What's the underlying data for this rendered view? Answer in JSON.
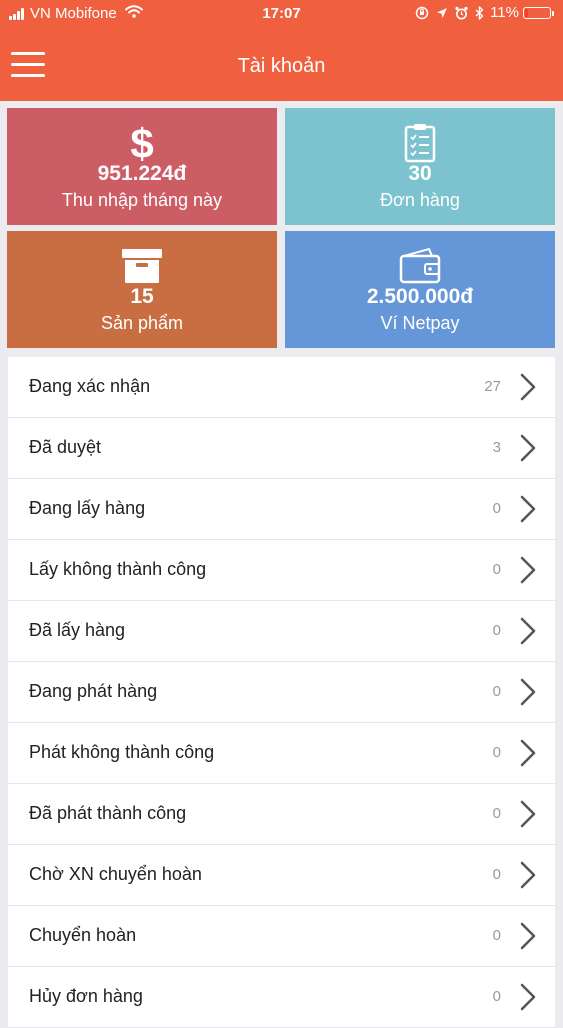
{
  "status_bar": {
    "carrier": "VN Mobifone",
    "time": "17:07",
    "battery": "11%"
  },
  "header": {
    "title": "Tài khoản",
    "menu_icon": "hamburger-menu-icon"
  },
  "tiles": [
    {
      "icon": "dollar-icon",
      "value": "951.224đ",
      "label": "Thu nhập tháng này",
      "color": "#cd5d65"
    },
    {
      "icon": "clipboard-icon",
      "value": "30",
      "label": "Đơn hàng",
      "color": "#7cc3cf"
    },
    {
      "icon": "archive-box-icon",
      "value": "15",
      "label": "Sản phẩm",
      "color": "#c96d42"
    },
    {
      "icon": "wallet-icon",
      "value": "2.500.000đ",
      "label": "Ví Netpay",
      "color": "#6597d8"
    }
  ],
  "list": [
    {
      "label": "Đang xác nhận",
      "count": "27"
    },
    {
      "label": "Đã duyệt",
      "count": "3"
    },
    {
      "label": "Đang lấy hàng",
      "count": "0"
    },
    {
      "label": "Lấy không thành công",
      "count": "0"
    },
    {
      "label": "Đã lấy hàng",
      "count": "0"
    },
    {
      "label": "Đang phát hàng",
      "count": "0"
    },
    {
      "label": "Phát không thành công",
      "count": "0"
    },
    {
      "label": "Đã phát thành công",
      "count": "0"
    },
    {
      "label": "Chờ XN chuyển hoàn",
      "count": "0"
    },
    {
      "label": "Chuyển hoàn",
      "count": "0"
    },
    {
      "label": "Hủy đơn hàng",
      "count": "0"
    }
  ],
  "colors": {
    "header": "#f0603e",
    "background": "#ececf0"
  }
}
